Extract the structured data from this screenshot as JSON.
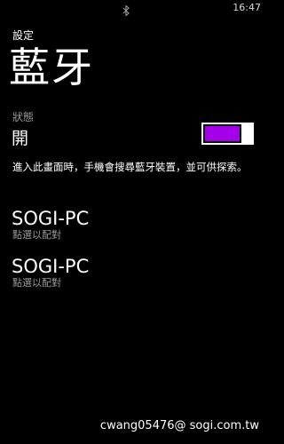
{
  "status_bar": {
    "icon": "bluetooth-icon",
    "time": "16:47"
  },
  "header": {
    "app_title": "設定",
    "page_title": "藍牙"
  },
  "status": {
    "label": "狀態",
    "value": "開",
    "toggle_on": true,
    "accent_color": "#a400ea"
  },
  "description": "進入此畫面時，手機會搜尋藍牙裝置，並可供探索。",
  "devices": [
    {
      "name": "SOGI-PC",
      "subtitle": "點選以配對"
    },
    {
      "name": "SOGI-PC",
      "subtitle": "點選以配對"
    }
  ],
  "watermark": "cwang05476@ sogi.com.tw"
}
